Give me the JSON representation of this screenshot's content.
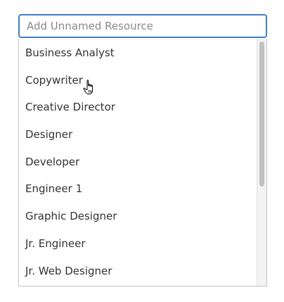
{
  "search": {
    "placeholder": "Add Unnamed Resource",
    "value": ""
  },
  "dropdown": {
    "items": [
      {
        "label": "Business Analyst"
      },
      {
        "label": "Copywriter"
      },
      {
        "label": "Creative Director"
      },
      {
        "label": "Designer"
      },
      {
        "label": "Developer"
      },
      {
        "label": "Engineer 1"
      },
      {
        "label": "Graphic Designer"
      },
      {
        "label": "Jr. Engineer"
      },
      {
        "label": "Jr. Web Designer"
      }
    ],
    "hovered_item": "Copywriter"
  },
  "cursor": {
    "icon": "hand-pointer-icon"
  },
  "colors": {
    "focus_border": "#3f7fc8",
    "text": "#333333",
    "placeholder": "#8a8a8a",
    "scroll_thumb": "#c1c1c1"
  }
}
